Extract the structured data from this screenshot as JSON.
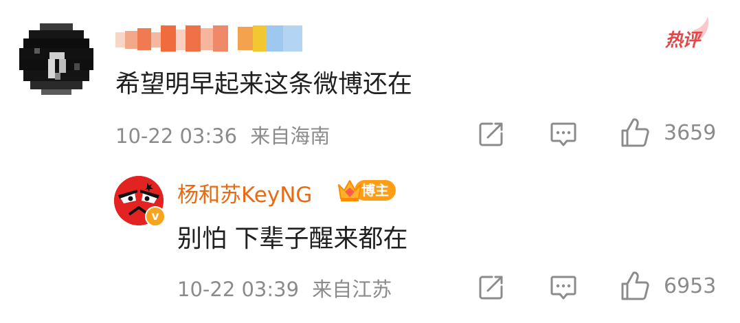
{
  "comment": {
    "content": "希望明早起来这条微博还在",
    "time": "10-22 03:36",
    "location": "来自海南",
    "like_count": "3659",
    "hot_label": "热评",
    "icons": {
      "share": "share-icon",
      "comment": "comment-icon",
      "like": "thumbs-up-icon"
    }
  },
  "reply": {
    "username": "杨和苏KeyNG",
    "badge_label": "博主",
    "verified_mark": "v",
    "content": "别怕 下辈子醒来都在",
    "time": "10-22 03:39",
    "location": "来自江苏",
    "like_count": "6953"
  },
  "colors": {
    "text": "#1f1f1f",
    "meta": "#8b8b8b",
    "username_orange": "#e86a12",
    "hot_red": "#e2474a",
    "badge_orange": "#ff9d16",
    "avatar_red": "#e32222"
  }
}
